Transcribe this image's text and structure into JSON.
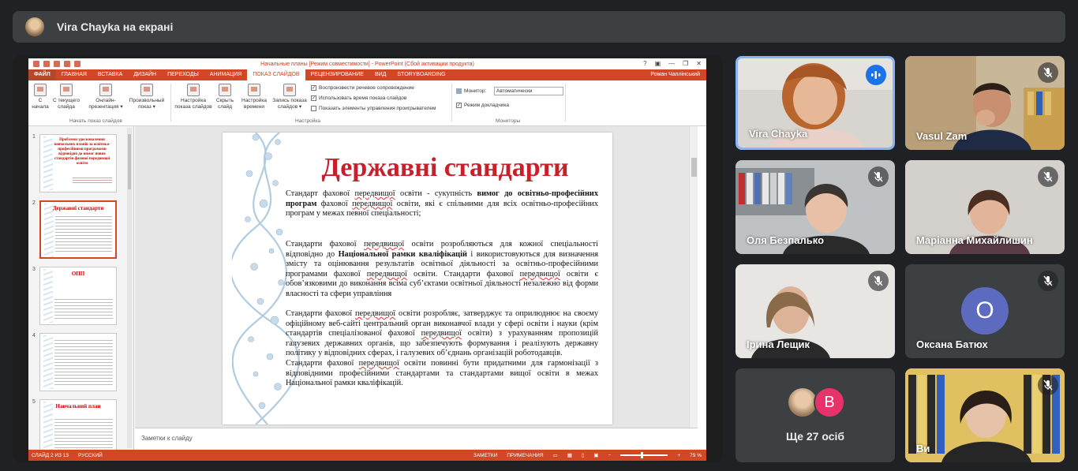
{
  "meeting": {
    "presenter_banner": "Vira Chayka на екрані"
  },
  "powerpoint": {
    "window_title": "Начальные планы [Режим совместимости] - PowerPoint (Сбой активации продукта)",
    "window_controls": [
      "?",
      "▣",
      "—",
      "❐",
      "✕"
    ],
    "user_name": "Роман Чаплінський",
    "tabs": [
      "ФАЙЛ",
      "ГЛАВНАЯ",
      "ВСТАВКА",
      "ДИЗАЙН",
      "ПЕРЕХОДЫ",
      "АНИМАЦИЯ",
      "ПОКАЗ СЛАЙДОВ",
      "РЕЦЕНЗИРОВАНИЕ",
      "ВИД",
      "STORYBOARDING"
    ],
    "active_tab_index": 6,
    "ribbon": {
      "buttons": [
        {
          "label": "С начала"
        },
        {
          "label": "С текущего слайда"
        },
        {
          "label": "Онлайн-презентация ▾"
        },
        {
          "label": "Произвольный показ ▾"
        },
        {
          "label": "Настройка показа слайдов"
        },
        {
          "label": "Скрыть слайд"
        },
        {
          "label": "Настройка времени"
        },
        {
          "label": "Запись показа слайдов ▾"
        }
      ],
      "group_start": "Начать показ слайдов",
      "group_setup": "Настройка",
      "group_monitors": "Мониторы",
      "checks": [
        {
          "label": "Воспроизвести речевое сопровождение",
          "checked": true
        },
        {
          "label": "Использовать время показа слайдов",
          "checked": true
        },
        {
          "label": "Показать элементы управления проигрывателем",
          "checked": false
        }
      ],
      "monitor_label": "Монитор:",
      "monitor_value": "Автоматически",
      "presenter_view_label": "Режим докладчика",
      "presenter_view_checked": true
    },
    "thumbnails": [
      {
        "num": "1",
        "title": "Проблеми удосконалення навчальних планів за освітньо-професійними програмами відповідно до вимог нових стандартів фахової передвищої освіти",
        "selected": false
      },
      {
        "num": "2",
        "title": "Державні стандарти",
        "selected": true
      },
      {
        "num": "3",
        "title": "ОПП",
        "selected": false
      },
      {
        "num": "4",
        "title": "",
        "selected": false
      },
      {
        "num": "5",
        "title": "Навчальний план",
        "selected": false
      }
    ],
    "slide": {
      "title": "Державні стандарти",
      "p1_a": "Стандарт фахової ",
      "p1_u1": "передвищої",
      "p1_b": " освіти - сукупність ",
      "p1_bold": "вимог до освітньо-професійних програм",
      "p1_c": " фахової ",
      "p1_u2": "передвищої",
      "p1_d": " освіти, які є спільними для всіх освітньо-професійних програм у межах певної спеціальності;",
      "p2_a": "Стандарти фахової ",
      "p2_u1": "передвищої",
      "p2_b": " освіти розробляються для кожної спеціальності відповідно до ",
      "p2_bold": "Національної рамки кваліфікацій",
      "p2_c": " і використовуються для визначення змісту та оцінювання результатів освітньої діяльності за освітньо-професійними програмами фахової ",
      "p2_u2": "передвищої",
      "p2_d": " освіти. Стандарти фахової ",
      "p2_u3": "передвищої",
      "p2_e": " освіти є обов’язковими до виконання всіма суб’єктами освітньої діяльності незалежно від форми власності та сфери управління",
      "p3_a": " Стандарти фахової ",
      "p3_u1": "передвищої",
      "p3_b": " освіти розробляє, затверджує та оприлюднює на своєму офіційному веб-сайті центральний орган виконавчої влади у сфері освіти і науки (крім стандартів спеціалізованої фахової ",
      "p3_u2": "передвищої",
      "p3_c": " освіти) з урахуванням пропозицій галузевих державних органів, що забезпечують формування і реалізують державну політику у відповідних сферах, і галузевих об’єднань організацій роботодавців.",
      "p4_a": "Стандарти фахової ",
      "p4_u1": "передвищої",
      "p4_b": " освіти повинні бути придатними для гармонізації з відповідними професійними стандартами та стандартами вищої освіти в межах Національної рамки кваліфікацій."
    },
    "notes_placeholder": "Заметки к слайду",
    "status": {
      "slide_info": "СЛАЙД 2 ИЗ 13",
      "language": "РУССКИЙ",
      "notes": "ЗАМЕТКИ",
      "comments": "ПРИМЕЧАНИЯ",
      "zoom": "79 %"
    }
  },
  "participants": [
    {
      "name": "Vira Chayka",
      "mic": "on",
      "active": true
    },
    {
      "name": "Vasul Zam",
      "mic": "muted"
    },
    {
      "name": "Оля Безпалько",
      "mic": "muted"
    },
    {
      "name": "Маріанна Михайлишин",
      "mic": "muted"
    },
    {
      "name": "Ірина Лещик",
      "mic": "muted"
    },
    {
      "name": "Оксана Батюх",
      "mic": "muted",
      "initial": "О"
    },
    {
      "name": "Ще 27 осіб",
      "initial": "В"
    },
    {
      "name": "Ви",
      "mic": "muted"
    }
  ],
  "colors": {
    "ppt_accent": "#d24726",
    "slide_title": "#c8202a",
    "meet_bg": "#202124",
    "active_border": "#8ab4f8"
  }
}
